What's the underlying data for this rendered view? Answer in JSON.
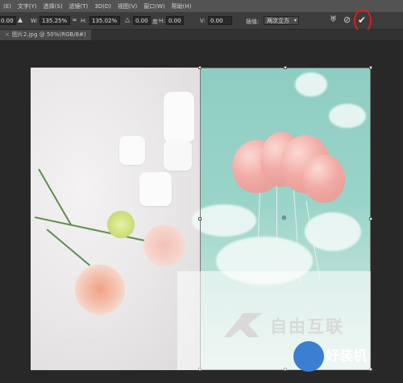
{
  "menu": [
    "(E)",
    "文字(Y)",
    "选择(S)",
    "滤镜(T)",
    "3D(D)",
    "视图(V)",
    "窗口(W)",
    "帮助(H)"
  ],
  "options": {
    "x_value": "0.00",
    "w_label": "W:",
    "w_value": "135.25%",
    "h_label": "H:",
    "h_value": "135.02%",
    "angle_value": "0.00",
    "angle_unit": "度",
    "hskew_label": "H:",
    "hskew_value": "0.00",
    "vskew_label": "V:",
    "vskew_value": "0.00",
    "interp_label": "插值:",
    "interp_value": "两次立方"
  },
  "tab": {
    "title": "图片2.jpg @ 50%(RGB/8#)"
  },
  "watermark": {
    "text": "自由互联",
    "logo_text": "好装机"
  },
  "accent": "#e51b1b"
}
